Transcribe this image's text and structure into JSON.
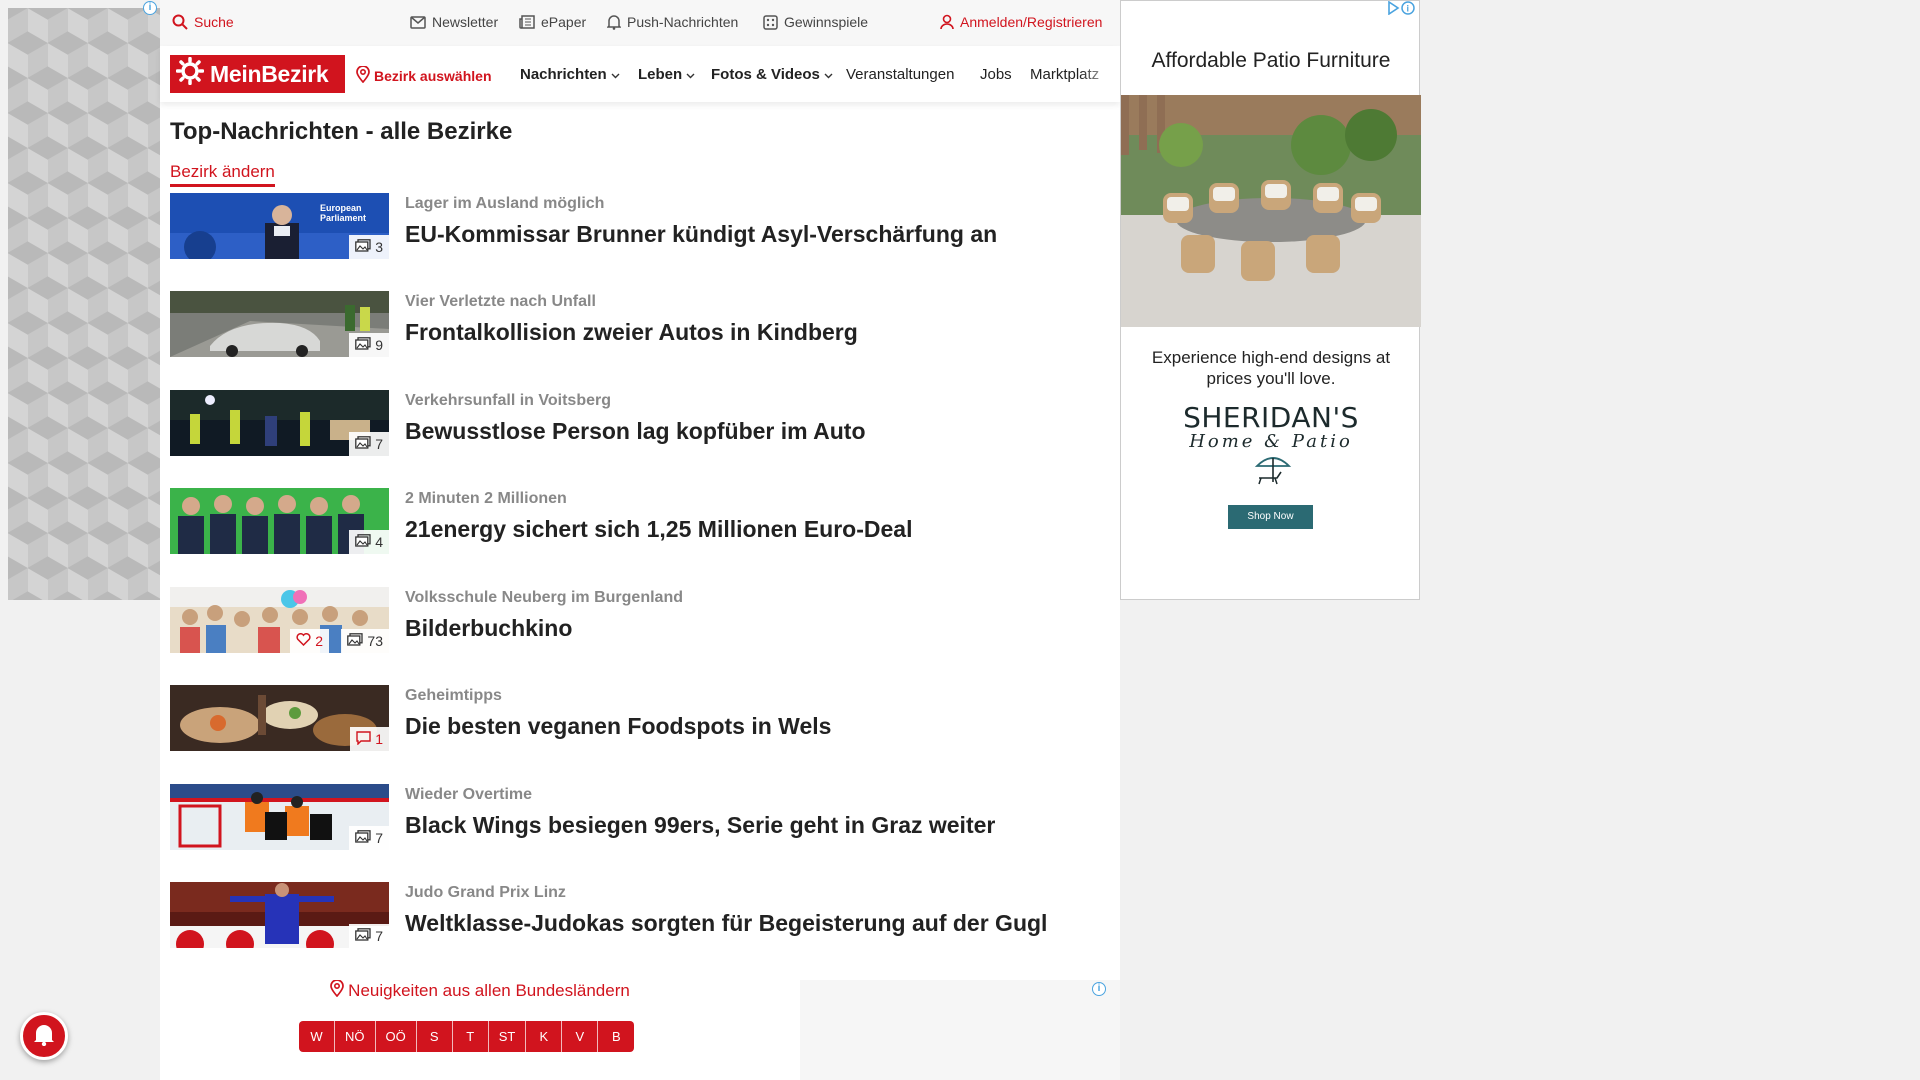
{
  "topbar": {
    "search": "Suche",
    "newsletter": "Newsletter",
    "epaper": "ePaper",
    "push": "Push-Nachrichten",
    "games": "Gewinnspiele",
    "login": "Anmelden/Registrieren"
  },
  "nav": {
    "logo": "MeinBezirk",
    "district_select": "Bezirk auswählen",
    "items": [
      {
        "label": "Nachrichten"
      },
      {
        "label": "Leben"
      },
      {
        "label": "Fotos & Videos"
      },
      {
        "label": "Veranstaltungen"
      },
      {
        "label": "Jobs"
      },
      {
        "label": "Marktplatz"
      }
    ]
  },
  "page": {
    "title": "Top-Nachrichten - alle Bezirke",
    "change_link": "Bezirk ändern"
  },
  "articles": [
    {
      "kicker": "Lager im Ausland möglich",
      "headline": "EU-Kommissar Brunner kündigt Asyl-Verschärfung an",
      "images": "3"
    },
    {
      "kicker": "Vier Verletzte nach Unfall",
      "headline": "Frontalkollision zweier Autos in Kindberg",
      "images": "9"
    },
    {
      "kicker": "Verkehrsunfall in Voitsberg",
      "headline": "Bewusstlose Person lag kopfüber im Auto",
      "images": "7"
    },
    {
      "kicker": "2 Minuten 2 Millionen",
      "headline": "21energy sichert sich 1,25 Millionen Euro-Deal",
      "images": "4"
    },
    {
      "kicker": "Volksschule Neuberg im Burgenland",
      "headline": "Bilderbuchkino",
      "images": "73",
      "likes": "2"
    },
    {
      "kicker": "Geheimtipps",
      "headline": "Die besten veganen Foodspots in Wels",
      "comments": "1"
    },
    {
      "kicker": "Wieder Overtime",
      "headline": "Black Wings besiegen 99ers, Serie geht in Graz weiter",
      "images": "7"
    },
    {
      "kicker": "Judo Grand Prix Linz",
      "headline": "Weltklasse-Judokas sorgten für Begeisterung auf der Gugl",
      "images": "7"
    }
  ],
  "bundeslaender": {
    "label": "Neuigkeiten aus allen Bundesländern",
    "states": [
      "W",
      "NÖ",
      "OÖ",
      "S",
      "T",
      "ST",
      "K",
      "V",
      "B"
    ]
  },
  "ad": {
    "title": "Affordable Patio Furniture",
    "text": "Experience high-end designs at prices you'll love.",
    "brand": "SHERIDAN'S",
    "brand_sub": "Home & Patio",
    "button": "Shop Now",
    "info_icon": "info-icon"
  },
  "colors": {
    "brand_red": "#d1141e",
    "ad_button": "#2b6a73"
  }
}
